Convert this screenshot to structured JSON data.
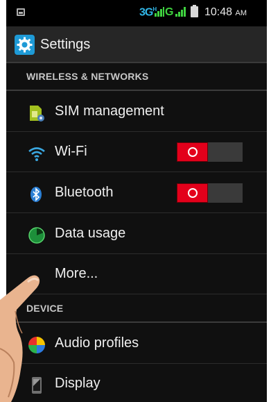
{
  "status_bar": {
    "network_type": "3G",
    "network_sup": "H",
    "network_type_2": "G",
    "time": "10:48",
    "ampm": "AM",
    "icons": [
      "gallery-icon",
      "signal-icon",
      "signal-icon",
      "battery-icon"
    ],
    "colors": {
      "network_3g": "#31b6e7",
      "network_g": "#3fd33f"
    }
  },
  "action_bar": {
    "title": "Settings",
    "icon": "settings-gear-icon",
    "icon_color": "#1e9ad6"
  },
  "sections": [
    {
      "header": "WIRELESS & NETWORKS",
      "items": [
        {
          "label": "SIM management",
          "icon": "sim-card-icon"
        },
        {
          "label": "Wi-Fi",
          "icon": "wifi-icon",
          "toggle": "off"
        },
        {
          "label": "Bluetooth",
          "icon": "bluetooth-icon",
          "toggle": "off"
        },
        {
          "label": "Data usage",
          "icon": "data-usage-icon"
        },
        {
          "label": "More...",
          "icon": "more-icon"
        }
      ]
    },
    {
      "header": "DEVICE",
      "items": [
        {
          "label": "Audio profiles",
          "icon": "audio-profiles-icon"
        },
        {
          "label": "Display",
          "icon": "display-icon"
        }
      ]
    }
  ],
  "toggle_colors": {
    "off_knob": "#e3001b",
    "track": "#3a3a3a"
  }
}
